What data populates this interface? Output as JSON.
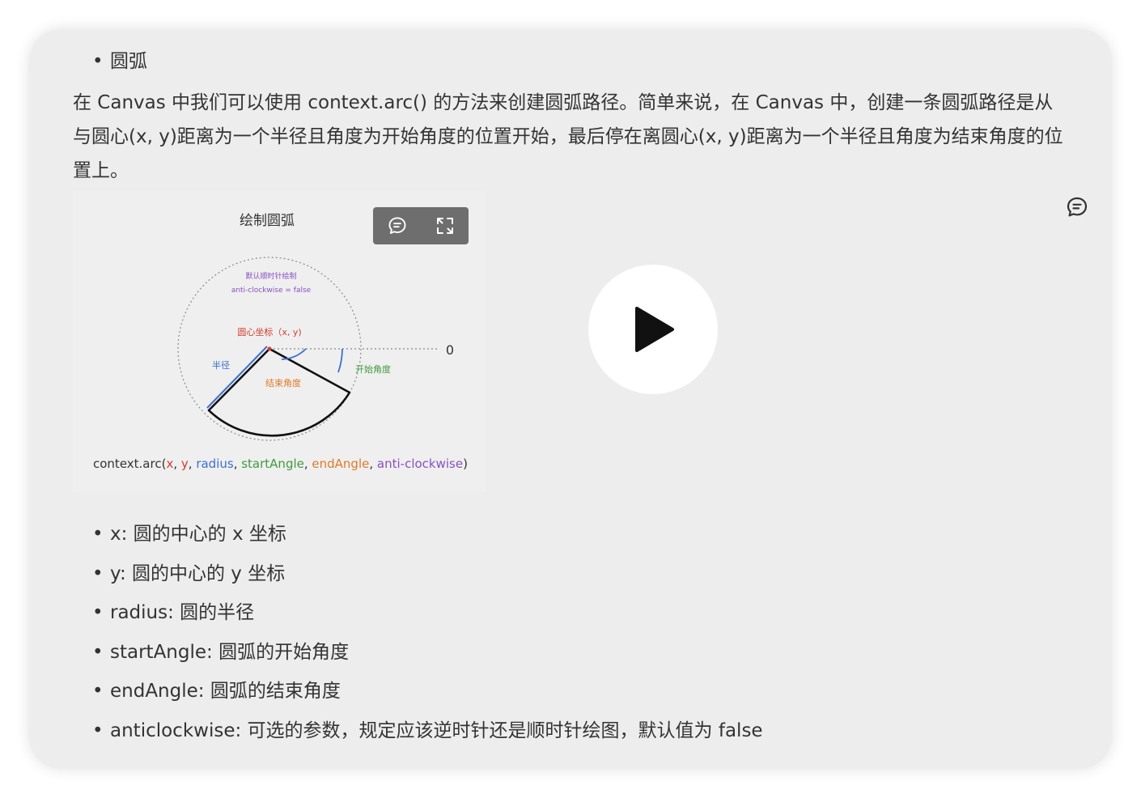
{
  "top_item": "圆弧",
  "paragraph": "在 Canvas 中我们可以使用 context.arc() 的方法来创建圆弧路径。简单来说，在 Canvas 中，创建一条圆弧路径是从与圆心(x, y)距离为一个半径且角度为开始角度的位置开始，最后停在离圆心(x, y)距离为一个半径且角度为结束角度的位置上。",
  "figure": {
    "title": "绘制圆弧",
    "label_default": "默认顺时针绘制",
    "label_anticlockwise": "anti-clockwise = false",
    "label_center": "圆心坐标（x, y)",
    "label_zero": "0",
    "label_radius": "半径",
    "label_start": "开始角度",
    "label_end": "结束角度",
    "signature": {
      "fn": "context.arc(",
      "x": "x",
      "y": "y",
      "radius": "radius",
      "start": "startAngle",
      "end": "endAngle",
      "anti": "anti-clockwise",
      "close": ")",
      "sep": ", "
    },
    "colors": {
      "x": "#d23c2e",
      "radius": "#3b6fd1",
      "start": "#3f9b3f",
      "end": "#e07b28",
      "anti": "#8a4fc2"
    }
  },
  "toolbar_icons": [
    "comment-icon",
    "fullscreen-icon"
  ],
  "side_icon": "comment-icon",
  "player_icon": "play-icon",
  "list": [
    "x: 圆的中心的 x 坐标",
    "y: 圆的中心的 y 坐标",
    "radius: 圆的半径",
    "startAngle: 圆弧的开始角度",
    "endAngle: 圆弧的结束角度",
    "anticlockwise: 可选的参数，规定应该逆时针还是顺时针绘图，默认值为 false"
  ]
}
